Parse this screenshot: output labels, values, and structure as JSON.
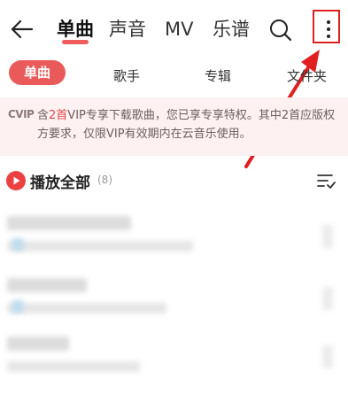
{
  "header": {
    "tabs": [
      {
        "label": "单曲",
        "active": true
      },
      {
        "label": "声音",
        "active": false
      },
      {
        "label": "MV",
        "active": false
      },
      {
        "label": "乐谱",
        "active": false
      }
    ],
    "icons": [
      "back-arrow-icon",
      "search-icon",
      "more-vertical-icon"
    ],
    "accent_color": "#ec4141"
  },
  "subtabs": [
    {
      "label": "单曲",
      "active": true
    },
    {
      "label": "歌手",
      "active": false
    },
    {
      "label": "专辑",
      "active": false
    },
    {
      "label": "文件夹",
      "active": false
    }
  ],
  "vip_notice": {
    "logo": "CVIP",
    "text_prefix": "含",
    "count": "2首",
    "text_suffix": "VIP专享下载歌曲，您已享专享特权。其中2首应版权方要求，仅限VIP有效期内在云音乐使用。"
  },
  "play_all": {
    "label": "播放全部",
    "count": "(8)"
  }
}
